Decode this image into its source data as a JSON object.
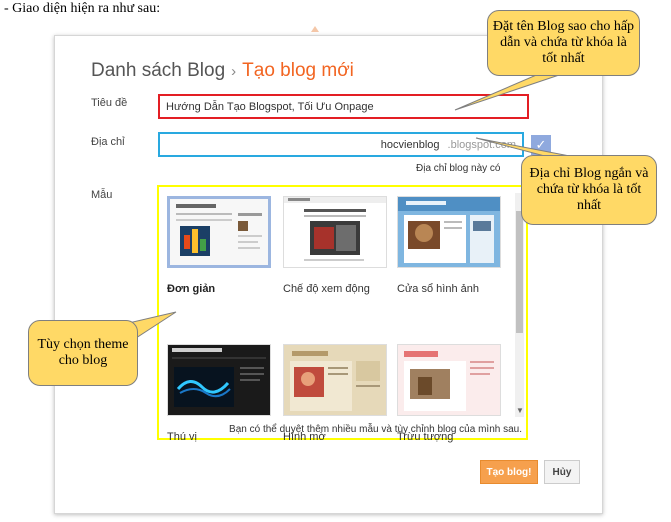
{
  "intro": "- Giao diện hiện ra như sau:",
  "heading": {
    "list": "Danh sách Blog",
    "separator": "›",
    "current": "Tạo blog mới"
  },
  "form": {
    "title_label": "Tiêu đề",
    "title_value": "Hướng Dẫn Tạo Blogspot, Tối Ưu Onpage",
    "address_label": "Địa chỉ",
    "address_value": "hocvienblog",
    "address_domain": ".blogspot.com",
    "address_hint": "Địa chỉ blog này có",
    "check_icon": "✓",
    "template_label": "Mẫu"
  },
  "templates": [
    {
      "name": "Đơn giản",
      "selected": true
    },
    {
      "name": "Chế độ xem động",
      "selected": false
    },
    {
      "name": "Cửa sổ hình ảnh",
      "selected": false
    },
    {
      "name": "Thú vị",
      "selected": false
    },
    {
      "name": "Hình mờ",
      "selected": false
    },
    {
      "name": "Trừu tượng",
      "selected": false
    }
  ],
  "templates_footer": "Bạn có thể duyệt thêm nhiều mẫu và tùy chỉnh blog của mình sau.",
  "buttons": {
    "create": "Tạo blog!",
    "cancel": "Hủy"
  },
  "callouts": {
    "title_tip": "Đặt tên Blog sao cho hấp dẫn và chứa từ khóa là tốt nhất",
    "address_tip": "Địa chỉ Blog ngắn và chứa từ khóa là tốt nhất",
    "theme_tip": "Tùy chọn theme cho blog"
  },
  "colors": {
    "accent_orange": "#f26522",
    "title_border": "#e31e24",
    "address_border": "#29a9e0",
    "template_border": "#ffff00",
    "callout_fill": "#ffd966"
  }
}
